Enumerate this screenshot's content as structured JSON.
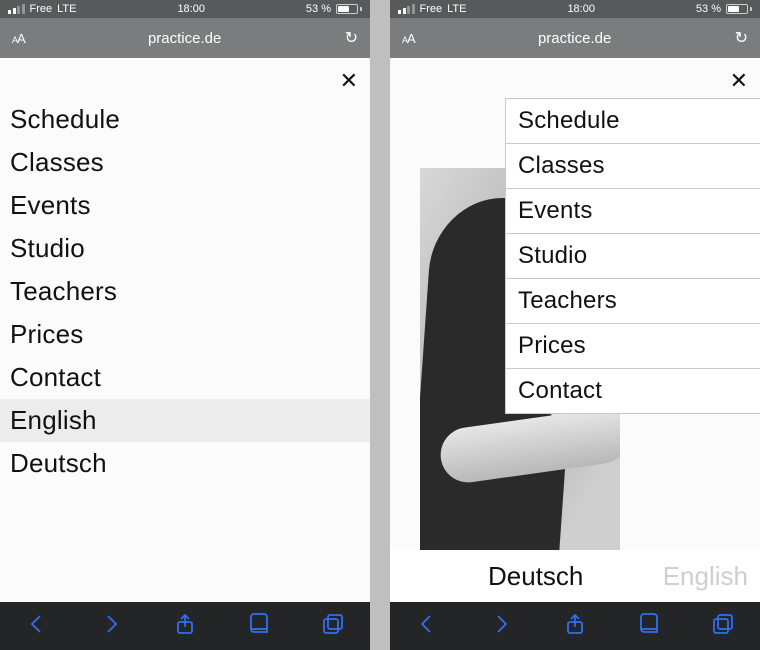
{
  "status": {
    "carrier": "Free",
    "network": "LTE",
    "time": "18:00",
    "battery_pct": "53 %",
    "battery_fill": 53
  },
  "browser": {
    "site": "practice.de"
  },
  "phoneA": {
    "menu": [
      {
        "label": "Schedule",
        "highlight": false
      },
      {
        "label": "Classes",
        "highlight": false
      },
      {
        "label": "Events",
        "highlight": false
      },
      {
        "label": "Studio",
        "highlight": false
      },
      {
        "label": "Teachers",
        "highlight": false
      },
      {
        "label": "Prices",
        "highlight": false
      },
      {
        "label": "Contact",
        "highlight": false
      },
      {
        "label": "English",
        "highlight": true
      },
      {
        "label": "Deutsch",
        "highlight": false
      }
    ]
  },
  "phoneB": {
    "menu": [
      {
        "label": "Schedule"
      },
      {
        "label": "Classes"
      },
      {
        "label": "Events"
      },
      {
        "label": "Studio"
      },
      {
        "label": "Teachers"
      },
      {
        "label": "Prices"
      },
      {
        "label": "Contact"
      }
    ],
    "lang_primary": "Deutsch",
    "lang_secondary": "English"
  }
}
